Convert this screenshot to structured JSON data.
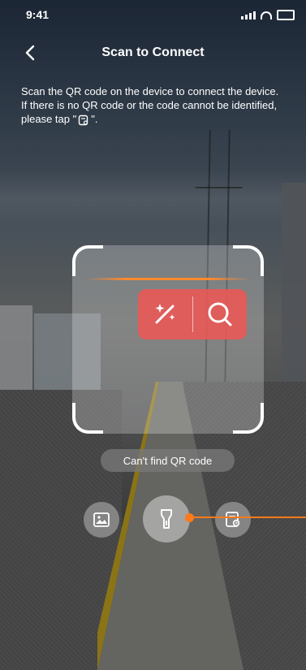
{
  "status_bar": {
    "time": "9:41"
  },
  "header": {
    "title": "Scan to Connect",
    "back_icon": "chevron-left-icon"
  },
  "instructions": {
    "line1": "Scan the QR code on the device to connect the device.",
    "line2_before": "If there is no QR code or the code cannot be identified, please tap \"",
    "line2_after": "\"."
  },
  "scan": {
    "ai_buttons": [
      "magic-wand-icon",
      "search-icon"
    ],
    "accent_color": "#ff7a1a",
    "ai_box_color": "#ec5854"
  },
  "hint": {
    "cant_find_label": "Can't find QR code"
  },
  "controls": {
    "left_icon": "image-gallery-icon",
    "middle_icon": "flashlight-icon",
    "right_icon": "manual-entry-icon"
  }
}
